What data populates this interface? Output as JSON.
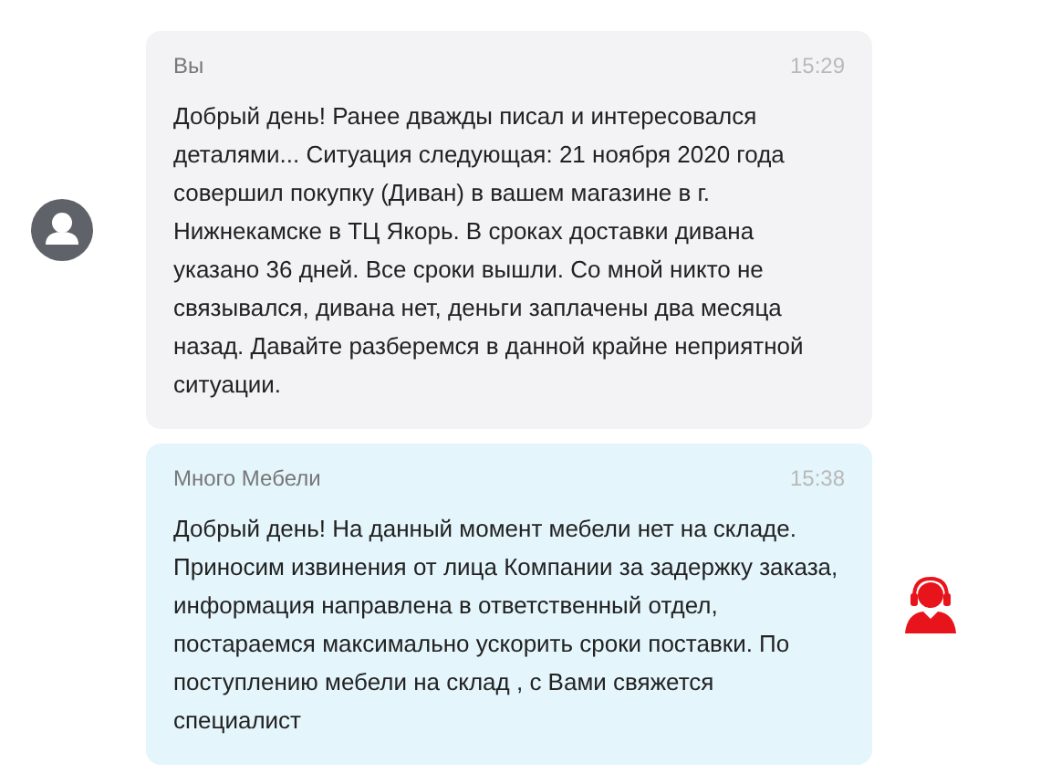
{
  "messages": [
    {
      "kind": "user",
      "author": "Вы",
      "time": "15:29",
      "text": "Добрый день! Ранее дважды писал и интересовался деталями... Ситуация следующая: 21 ноября 2020 года совершил покупку (Диван) в вашем магазине в г. Нижнекамске в ТЦ Якорь. В сроках доставки дивана указано 36 дней. Все сроки вышли. Со мной никто не связывался, дивана нет, деньги заплачены два месяца назад. Давайте разберемся в данной крайне неприятной ситуации."
    },
    {
      "kind": "agent",
      "author": "Много Мебели",
      "time": "15:38",
      "text": "Добрый день! На данный момент мебели нет на складе. Приносим извинения от лица Компании за задержку заказа, информация направлена в ответственный отдел, постараемся максимально ускорить сроки поставки. По поступлению мебели на склад , с Вами свяжется специалист"
    }
  ]
}
